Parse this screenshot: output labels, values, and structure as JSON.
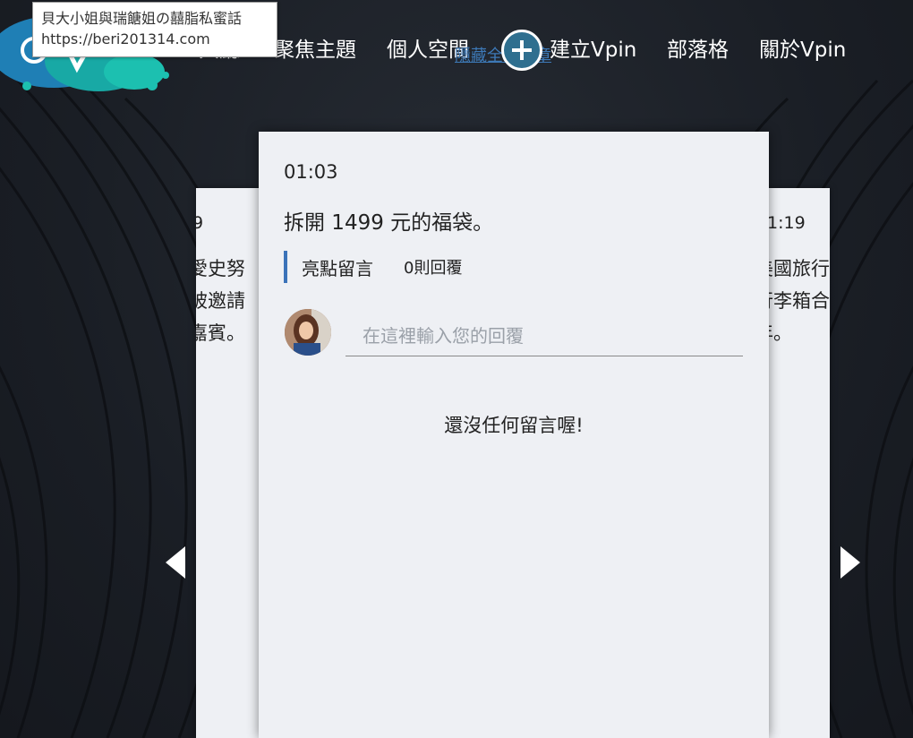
{
  "tooltip": {
    "title": "貝大小姐與瑞餹姐の囍脂私蜜話",
    "url": "https://beri201314.com"
  },
  "nav": {
    "items": [
      {
        "label": "大廳"
      },
      {
        "label": "聚焦主題"
      },
      {
        "label": "個人空間"
      },
      {
        "label": "建立Vpin"
      },
      {
        "label": "部落格"
      },
      {
        "label": "關於Vpin"
      }
    ],
    "hidden_link": "隱藏全部文章"
  },
  "left_card": {
    "time": "9",
    "lines": [
      "愛史努",
      "被邀請",
      "嘉賓。"
    ]
  },
  "right_card": {
    "time": "1:19",
    "lines": [
      "美國旅行",
      "行李箱合",
      "年。"
    ]
  },
  "main_card": {
    "time": "01:03",
    "title": "拆開 1499 元的福袋。",
    "highlight_label": "亮點留言",
    "reply_count": "0則回覆",
    "reply_placeholder": "在這裡輸入您的回覆",
    "empty_text": "還沒任何留言喔!"
  },
  "icons": {
    "logo": "vpin-logo",
    "plus": "plus-icon",
    "prev": "chevron-left-icon",
    "next": "chevron-right-icon"
  },
  "colors": {
    "accent_blue": "#3b73b9",
    "card_bg": "#eef0f4",
    "page_bg": "#1b1f26"
  }
}
